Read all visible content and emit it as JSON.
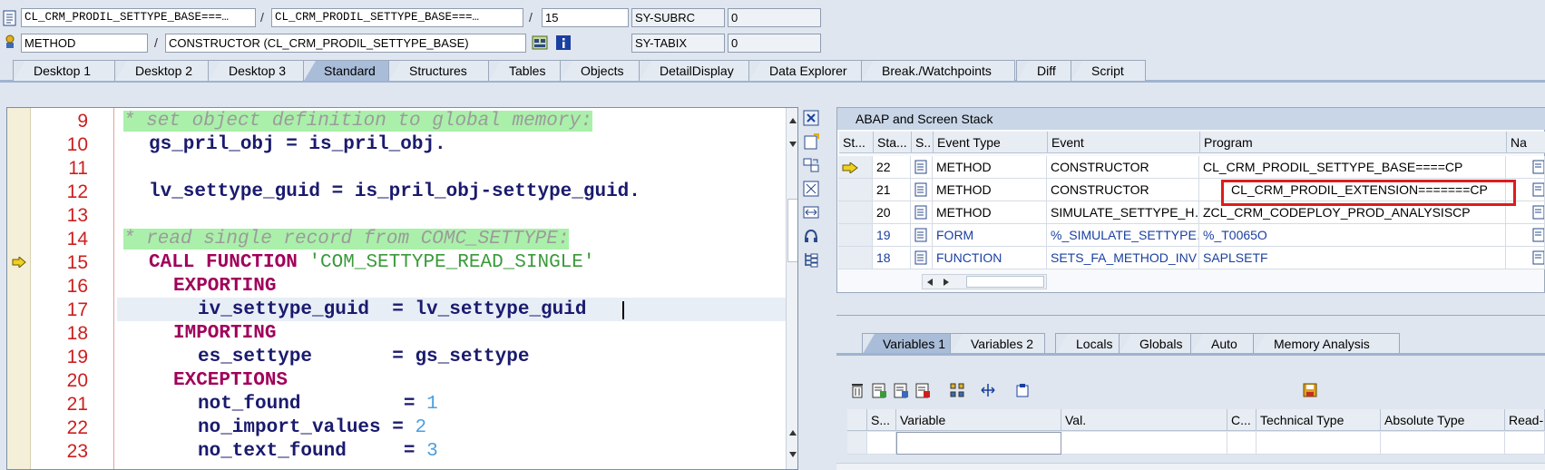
{
  "header": {
    "program_field": "CL_CRM_PRODIL_SETTYPE_BASE===…",
    "include_field": "CL_CRM_PRODIL_SETTYPE_BASE===…",
    "separator": "/",
    "line_field": "15",
    "sysubrc_label": "SY-SUBRC",
    "sysubrc_value": "0",
    "event_type_field": "METHOD",
    "event_field": "CONSTRUCTOR (CL_CRM_PRODIL_SETTYPE_BASE)",
    "sytabix_label": "SY-TABIX",
    "sytabix_value": "0"
  },
  "tabs": [
    {
      "label": "Desktop 1"
    },
    {
      "label": "Desktop 2"
    },
    {
      "label": "Desktop 3"
    },
    {
      "label": "Standard",
      "active": true
    },
    {
      "label": "Structures"
    },
    {
      "label": "Tables"
    },
    {
      "label": "Objects"
    },
    {
      "label": "DetailDisplay"
    },
    {
      "label": "Data Explorer"
    },
    {
      "label": "Break./Watchpoints"
    },
    {
      "label": "Diff"
    },
    {
      "label": "Script"
    }
  ],
  "editor": {
    "line_numbers": [
      "9",
      "10",
      "11",
      "12",
      "13",
      "14",
      "15",
      "16",
      "17",
      "18",
      "19",
      "20",
      "21",
      "22",
      "23"
    ],
    "lines": {
      "l9_comment": "* set object definition to global memory:",
      "l10": "gs_pril_obj = is_pril_obj.",
      "l11": "",
      "l12": "lv_settype_guid = is_pril_obj-settype_guid.",
      "l13": "",
      "l14_comment": "* read single record from COMC_SETTYPE:",
      "l15_kw": "CALL FUNCTION",
      "l15_str": "'COM_SETTYPE_READ_SINGLE'",
      "l16_kw": "EXPORTING",
      "l17": "iv_settype_guid  = lv_settype_guid",
      "l18_kw": "IMPORTING",
      "l19": "es_settype       = gs_settype",
      "l20_kw": "EXCEPTIONS",
      "l21_name": "not_found         =",
      "l21_num": "1",
      "l22_name": "no_import_values =",
      "l22_num": "2",
      "l23_name": "no_text_found     =",
      "l23_num": "3"
    },
    "current_line": "15"
  },
  "stack": {
    "title": "ABAP and Screen Stack",
    "columns": [
      "St...",
      "Sta...",
      "S..",
      "Event Type",
      "Event",
      "Program",
      "Na"
    ],
    "rows": [
      {
        "level": "22",
        "event_type": "METHOD",
        "event": "CONSTRUCTOR",
        "program": "CL_CRM_PRODIL_SETTYPE_BASE====CP",
        "current": true
      },
      {
        "level": "21",
        "event_type": "METHOD",
        "event": "CONSTRUCTOR",
        "program": "CL_CRM_PRODIL_EXTENSION=======CP",
        "highlighted": true
      },
      {
        "level": "20",
        "event_type": "METHOD",
        "event": "SIMULATE_SETTYPE_H…",
        "program": "ZCL_CRM_CODEPLOY_PROD_ANALYSISCP"
      },
      {
        "level": "19",
        "event_type": "FORM",
        "event": "%_SIMULATE_SETTYPE…",
        "program": "%_T0065O"
      },
      {
        "level": "18",
        "event_type": "FUNCTION",
        "event": "SETS_FA_METHOD_INV…",
        "program": "SAPLSETF"
      }
    ]
  },
  "variables": {
    "tabs": [
      {
        "label": "Variables 1",
        "active": true
      },
      {
        "label": "Variables 2"
      },
      {
        "label": "Locals"
      },
      {
        "label": "Globals"
      },
      {
        "label": "Auto"
      },
      {
        "label": "Memory Analysis"
      }
    ],
    "columns": [
      "S...",
      "Variable",
      "Val.",
      "C...",
      "Technical Type",
      "Absolute Type",
      "Read-"
    ]
  },
  "colors": {
    "line_number": "#cc1f1f",
    "keyword": "#a0005a",
    "comment_bg": "#aaf0aa",
    "highlight_box": "#e01b1b",
    "active_tab": "#a9bcd8"
  }
}
